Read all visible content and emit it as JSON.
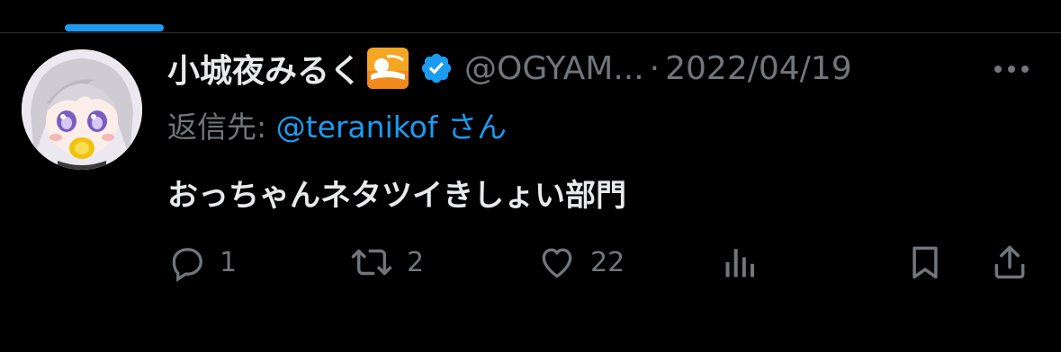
{
  "tweet": {
    "display_name": "小城夜みるく",
    "handle": "@OGYAM...",
    "separator": "·",
    "date": "2022/04/19",
    "reply_label": "返信先:",
    "reply_mention": "@teranikof",
    "reply_suffix": "さん",
    "text": "おっちゃんネタツイきしょい部門"
  },
  "actions": {
    "reply": {
      "icon": "reply-icon",
      "count": "1"
    },
    "retweet": {
      "icon": "retweet-icon",
      "count": "2"
    },
    "like": {
      "icon": "heart-icon",
      "count": "22"
    },
    "views": {
      "icon": "analytics-icon"
    },
    "bookmark": {
      "icon": "bookmark-icon"
    },
    "share": {
      "icon": "share-icon"
    }
  },
  "colors": {
    "background": "#000000",
    "text": "#e7e9ea",
    "muted": "#71767b",
    "accent": "#1d9bf0"
  }
}
